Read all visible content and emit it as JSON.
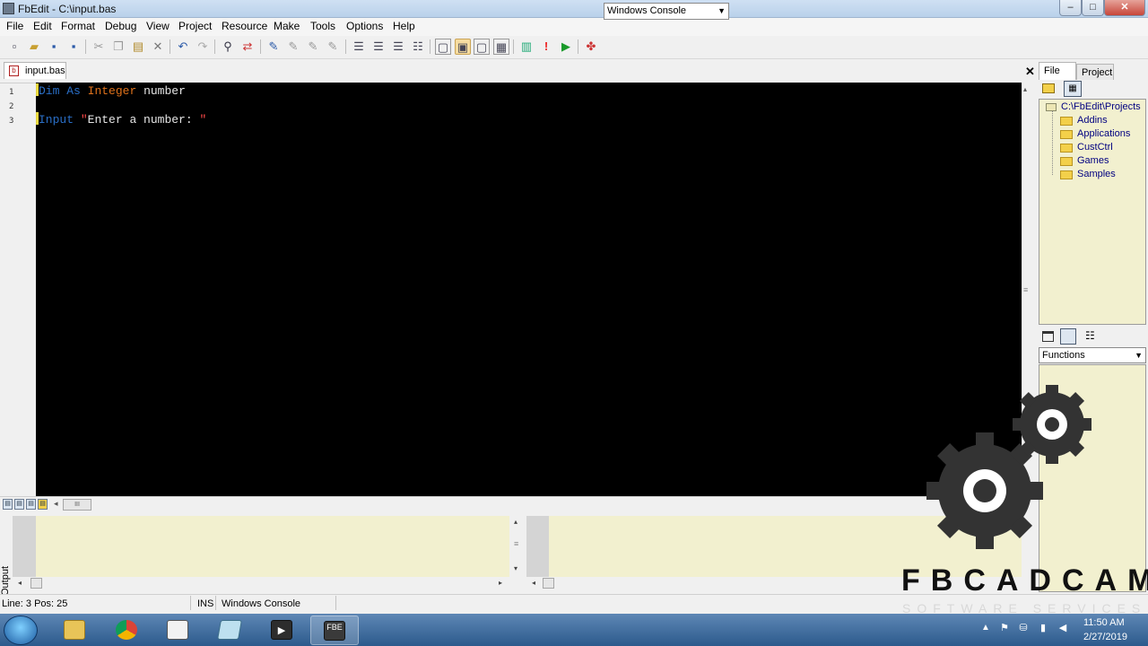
{
  "window": {
    "title": "FbEdit - C:\\input.bas",
    "min_glyph": "–",
    "max_glyph": "□",
    "close_glyph": "✕"
  },
  "menu": [
    "File",
    "Edit",
    "Format",
    "Debug",
    "View",
    "Project",
    "Resource",
    "Make",
    "Tools",
    "Options",
    "Help"
  ],
  "toolbar": {
    "build_config": "Windows Console",
    "dropdown_glyph": "▼"
  },
  "document": {
    "tab_label": "input.bas",
    "tab_icon_glyph": "b",
    "close_glyph": "✕"
  },
  "editor": {
    "line_numbers": [
      "1",
      "2",
      "3"
    ],
    "line1": {
      "kw1": "Dim",
      "kw2": "As",
      "type": "Integer",
      "ident": "number"
    },
    "line3": {
      "kw": "Input",
      "quote_open": "\"",
      "text": "Enter a number: ",
      "quote_close": "\""
    }
  },
  "output_panel": {
    "label": "Output",
    "scroll_left": "◂",
    "scroll_right": "▸",
    "scroll_up": "▴",
    "scroll_down": "▾",
    "thumb": "III",
    "grip": "≡"
  },
  "right_panel": {
    "tabs": [
      "File",
      "Project"
    ],
    "root": "C:\\FbEdit\\Projects",
    "folders": [
      "Addins",
      "Applications",
      "CustCtrl",
      "Games",
      "Samples"
    ],
    "functions_label": "Functions"
  },
  "statusbar": {
    "position": "Line: 3 Pos: 25",
    "mode": "INS",
    "build": "Windows Console"
  },
  "watermark": {
    "brand": "FBCADCAM",
    "sub": "SOFTWARE SERVICES"
  },
  "taskbar": {
    "time": "11:50 AM",
    "date": "2/27/2019",
    "app_label": "FBE",
    "tray_up": "▲"
  },
  "colors": {
    "editor_bg": "#000000",
    "keyword": "#2a6fc8",
    "type": "#e0721b",
    "string": "#ff4a4a",
    "pane_bg": "#f2f0cf"
  }
}
